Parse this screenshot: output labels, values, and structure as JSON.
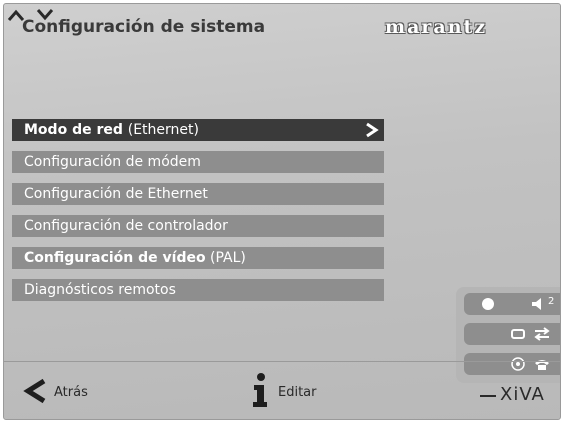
{
  "header": {
    "title": "Configuración de sistema",
    "brand_logo_text": "marantz"
  },
  "menu": {
    "items": [
      {
        "label": "Modo de red",
        "extra": "(Ethernet)",
        "selected": true
      },
      {
        "label": "Configuración de módem",
        "extra": "",
        "selected": false
      },
      {
        "label": "Configuración de Ethernet",
        "extra": "",
        "selected": false
      },
      {
        "label": "Configuración de controlador",
        "extra": "",
        "selected": false
      },
      {
        "label": "Configuración de vídeo",
        "extra": "(PAL)",
        "selected": false
      },
      {
        "label": "Diagnósticos remotos",
        "extra": "",
        "selected": false
      }
    ]
  },
  "status": {
    "volume_level": "2",
    "icons": [
      "record-dot-icon",
      "volume-icon",
      "repeat-icon",
      "shuffle-icon",
      "disc-icon",
      "phone-icon"
    ]
  },
  "footer": {
    "back_label": "Atrás",
    "edit_label": "Editar",
    "xiva_logo_text": "XiVA"
  },
  "colors": {
    "background": "#c4c4c4",
    "menu_item": "#8e8e8e",
    "menu_item_selected": "#3a3a3a",
    "text_dark": "#3a3a3a"
  }
}
